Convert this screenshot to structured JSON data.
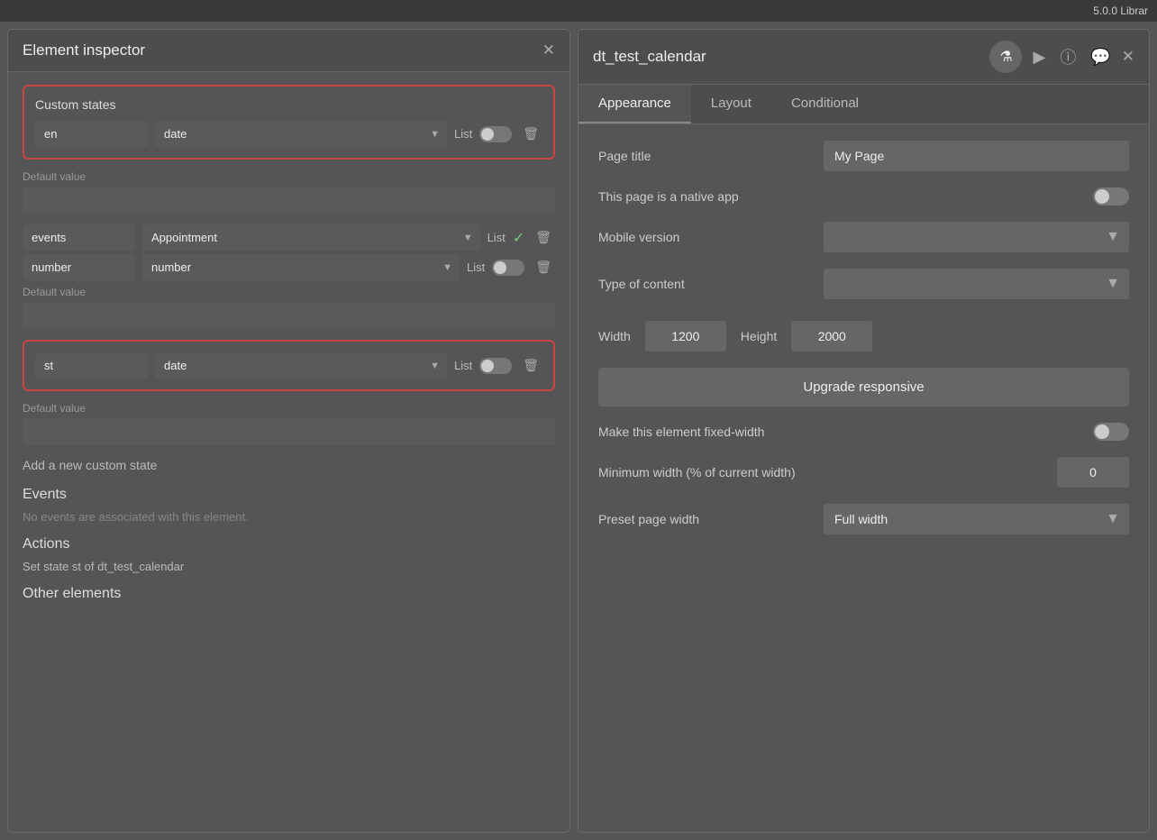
{
  "topbar": {
    "version": "5.0.0 Librar"
  },
  "leftPanel": {
    "title": "Element inspector",
    "closeLabel": "✕",
    "customStates": {
      "title": "Custom states",
      "states": [
        {
          "name": "en",
          "type": "date",
          "listLabel": "List",
          "hasToggle": false,
          "toggleOn": false
        },
        {
          "name": "events",
          "type": "Appointment",
          "listLabel": "List",
          "hasToggle": true,
          "toggleOn": true
        },
        {
          "name": "number",
          "type": "number",
          "listLabel": "List",
          "hasToggle": false,
          "toggleOn": false
        },
        {
          "name": "st",
          "type": "date",
          "listLabel": "List",
          "hasToggle": false,
          "toggleOn": false
        }
      ],
      "defaultValueLabel": "Default value"
    },
    "addStateLabel": "Add a new custom state",
    "eventsTitle": "Events",
    "noEventsText": "No events are associated with this element.",
    "actionsTitle": "Actions",
    "actionItem": "Set state st of dt_test_calendar",
    "otherElementsTitle": "Other elements"
  },
  "rightPanel": {
    "pageName": "dt_test_calendar",
    "tabs": [
      {
        "label": "Appearance",
        "active": true
      },
      {
        "label": "Layout",
        "active": false
      },
      {
        "label": "Conditional",
        "active": false
      }
    ],
    "fields": {
      "pageTitleLabel": "Page title",
      "pageTitleValue": "My Page",
      "nativeAppLabel": "This page is a native app",
      "mobileVersionLabel": "Mobile version",
      "typeOfContentLabel": "Type of content",
      "widthLabel": "Width",
      "widthValue": "1200",
      "heightLabel": "Height",
      "heightValue": "2000",
      "upgradeLabel": "Upgrade responsive",
      "fixedWidthLabel": "Make this element fixed-width",
      "minWidthLabel": "Minimum width (% of current width)",
      "minWidthValue": "0",
      "presetPageWidthLabel": "Preset page width",
      "presetPageWidthValue": "Full width"
    },
    "icons": {
      "flask": "⚗",
      "play": "▶",
      "info": "ⓘ",
      "chat": "💬",
      "close": "✕"
    }
  }
}
